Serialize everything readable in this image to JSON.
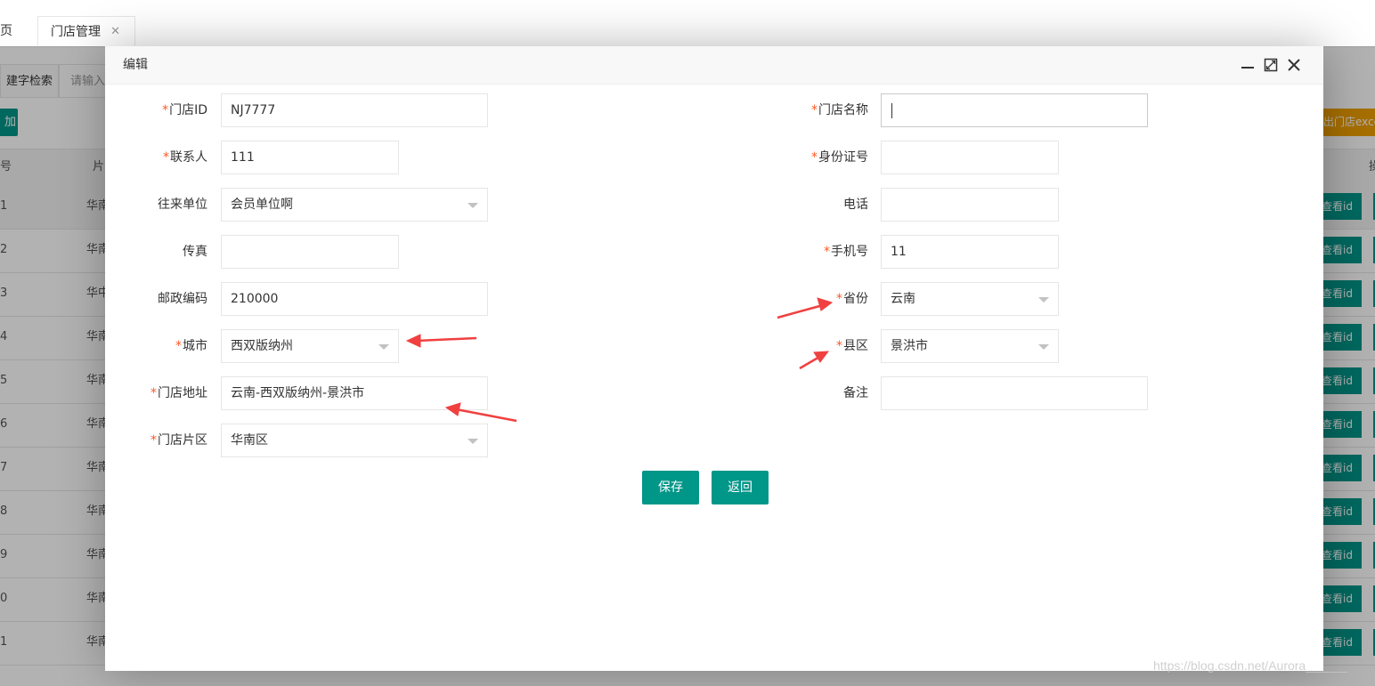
{
  "tabs": {
    "home_label": "页",
    "store_label": "门店管理",
    "close_glyph": "✕"
  },
  "background": {
    "search_label": "建字检索",
    "search_placeholder": "请输入",
    "add_label": "加",
    "export_label": "出门店excel",
    "col_index": "号",
    "col_region": "片",
    "col_right": "操",
    "rows": [
      {
        "idx": "1",
        "region": "华南",
        "action": "查看id"
      },
      {
        "idx": "2",
        "region": "华南",
        "action": "查看id"
      },
      {
        "idx": "3",
        "region": "华中",
        "action": "查看id"
      },
      {
        "idx": "4",
        "region": "华南",
        "action": "查看id"
      },
      {
        "idx": "5",
        "region": "华南",
        "action": "查看id"
      },
      {
        "idx": "6",
        "region": "华南",
        "action": "查看id"
      },
      {
        "idx": "7",
        "region": "华南",
        "action": "查看id"
      },
      {
        "idx": "8",
        "region": "华南",
        "action": "查看id"
      },
      {
        "idx": "9",
        "region": "华南",
        "action": "查看id"
      },
      {
        "idx": "0",
        "region": "华南",
        "action": "查看id"
      },
      {
        "idx": "1",
        "region": "华南",
        "action": "查看id"
      }
    ]
  },
  "modal": {
    "title": "编辑",
    "icons": [
      "minimize-icon",
      "maximize-icon",
      "close-icon"
    ],
    "required_mark": "*",
    "fields": {
      "store_id": {
        "label": "门店ID",
        "value": "NJ7777",
        "required": true
      },
      "store_name": {
        "label": "门店名称",
        "value": "",
        "required": true
      },
      "contact": {
        "label": "联系人",
        "value": "111",
        "required": true
      },
      "id_number": {
        "label": "身份证号",
        "value": "",
        "required": true
      },
      "partner": {
        "label": "往来单位",
        "value": "会员单位啊",
        "required": false
      },
      "phone": {
        "label": "电话",
        "value": "",
        "required": false
      },
      "fax": {
        "label": "传真",
        "value": "",
        "required": false
      },
      "mobile": {
        "label": "手机号",
        "value": "11",
        "required": true
      },
      "postcode": {
        "label": "邮政编码",
        "value": "210000",
        "required": false
      },
      "province": {
        "label": "省份",
        "value": "云南",
        "required": true
      },
      "city": {
        "label": "城市",
        "value": "西双版纳州",
        "required": true
      },
      "county": {
        "label": "县区",
        "value": "景洪市",
        "required": true
      },
      "address": {
        "label": "门店地址",
        "value": "云南-西双版纳州-景洪市",
        "required": true
      },
      "remark": {
        "label": "备注",
        "value": "",
        "required": false
      },
      "area": {
        "label": "门店片区",
        "value": "华南区",
        "required": true
      }
    },
    "save_label": "保存",
    "back_label": "返回"
  },
  "watermark": "https://blog.csdn.net/Aurora______",
  "colors": {
    "primary": "#009688",
    "required": "#ff5722",
    "annotation_arrow": "#f04040",
    "export": "#f0a000"
  }
}
